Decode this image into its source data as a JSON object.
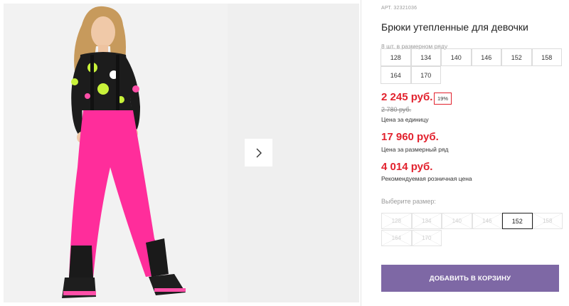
{
  "gallery": {
    "photo_alt": "product-photo",
    "next_icon": "chevron-right-icon"
  },
  "product": {
    "art": "АРТ. 32321036",
    "title": "Брюки утепленные для девочки",
    "size_row_label": "8 шт. в размерном ряду",
    "sizes": [
      "128",
      "134",
      "140",
      "146",
      "152",
      "158",
      "164",
      "170"
    ]
  },
  "prices": {
    "unit_price": "2 245 руб.",
    "discount_badge": "19%",
    "old_price": "2 780 руб.",
    "unit_caption": "Цена за единицу",
    "row_price": "17 960 руб.",
    "row_caption": "Цена за размерный ряд",
    "retail_price": "4 014 руб.",
    "retail_caption": "Рекомендуемая розничная цена"
  },
  "size_picker": {
    "label": "Выберите размер:",
    "selected": "152",
    "options": [
      "128",
      "134",
      "140",
      "146",
      "152",
      "158",
      "164",
      "170"
    ]
  },
  "cart": {
    "button_label": "ДОБАВИТЬ В КОРЗИНУ"
  },
  "colors": {
    "price_red": "#e2222e",
    "cart_purple": "#7e68a5",
    "pants_pink": "#ff2d9b"
  }
}
